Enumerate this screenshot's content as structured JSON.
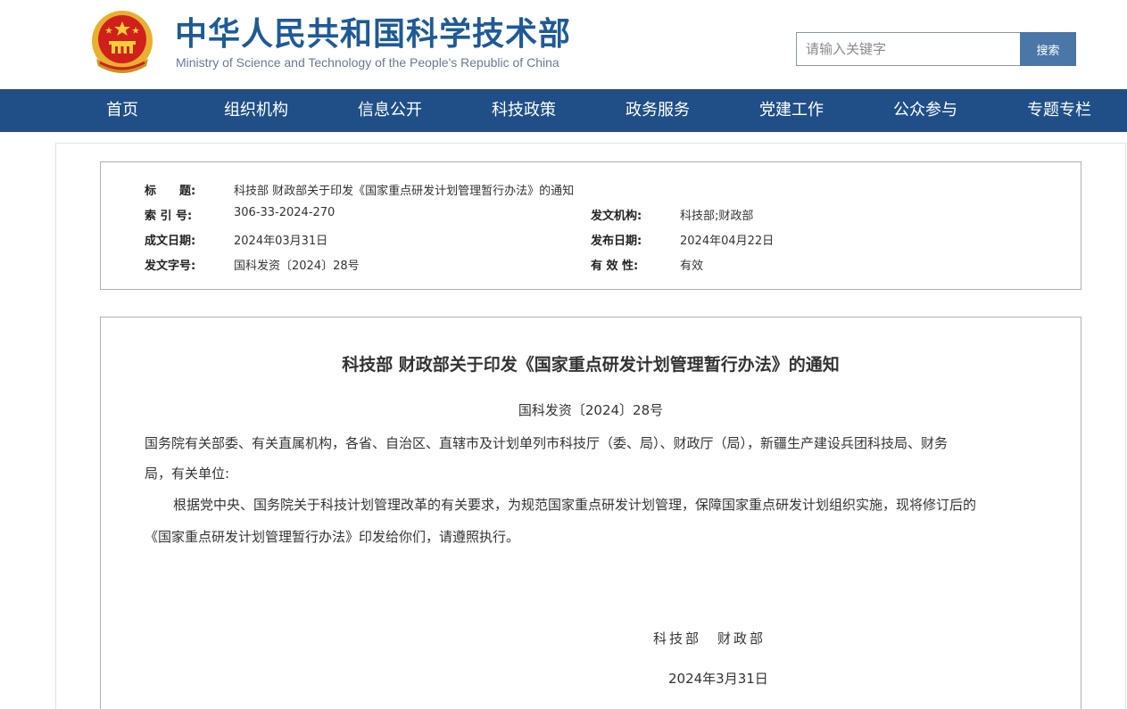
{
  "header": {
    "title": "中华人民共和国科学技术部",
    "subtitle": "Ministry of Science and Technology of the People's Republic of China",
    "search": {
      "placeholder": "请输入关键字",
      "button_label": "搜索"
    }
  },
  "nav": {
    "items": [
      {
        "label": "首页"
      },
      {
        "label": "组织机构"
      },
      {
        "label": "信息公开"
      },
      {
        "label": "科技政策"
      },
      {
        "label": "政务服务"
      },
      {
        "label": "党建工作"
      },
      {
        "label": "公众参与"
      },
      {
        "label": "专题专栏"
      }
    ]
  },
  "meta": {
    "title_label": "标　　题:",
    "title_value": "科技部 财政部关于印发《国家重点研发计划管理暂行办法》的通知",
    "index_label": "索 引 号:",
    "index_value": "306-33-2024-270",
    "issuer_label": "发文机构:",
    "issuer_value": "科技部;财政部",
    "created_label": "成文日期:",
    "created_value": "2024年03月31日",
    "published_label": "发布日期:",
    "published_value": "2024年04月22日",
    "docno_label": "发文字号:",
    "docno_value": "国科发资〔2024〕28号",
    "validity_label": "有 效 性:",
    "validity_value": "有效"
  },
  "article": {
    "title": "科技部 财政部关于印发《国家重点研发计划管理暂行办法》的通知",
    "doc_number": "国科发资〔2024〕28号",
    "addressee_line1": "国务院有关部委、有关直属机构，各省、自治区、直辖市及计划单列市科技厅（委、局）、财政厅（局），新疆生产建设兵团科技局、财务",
    "addressee_line2": "局，有关单位:",
    "body_line1": "根据党中央、国务院关于科技计划管理改革的有关要求，为规范国家重点研发计划管理，保障国家重点研发计划组织实施，现将修订后的",
    "body_line2": "《国家重点研发计划管理暂行办法》印发给你们，请遵照执行。",
    "signers": "科技部　财政部",
    "sign_date": "2024年3月31日"
  },
  "colors": {
    "brand_blue": "#1f5a96",
    "nav_bg": "#1f4f86",
    "search_button": "#4a76a8",
    "emblem_gold": "#e8b030",
    "emblem_red": "#d0201c"
  },
  "icons": {
    "emblem": "national-emblem-icon"
  }
}
